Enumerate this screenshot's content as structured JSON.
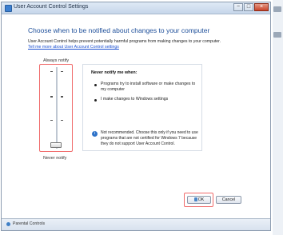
{
  "window": {
    "title": "User Account Control Settings",
    "minimize_glyph": "−",
    "maximize_glyph": "□",
    "close_glyph": "×"
  },
  "main": {
    "heading": "Choose when to be notified about changes to your computer",
    "intro": "User Account Control helps prevent potentially harmful programs from making changes to your computer.",
    "intro_link": "Tell me more about User Account Control settings"
  },
  "slider": {
    "top_label": "Always notify",
    "bottom_label": "Never notify",
    "level": 0,
    "levels": 4
  },
  "description": {
    "title": "Never notify me when:",
    "bullets": [
      "Programs try to install software or make changes to my computer",
      "I make changes to Windows settings"
    ],
    "warning": "Not recommended. Choose this only if you need to use programs that are not certified for Windows 7 because they do not support User Account Control.",
    "info_glyph": "i"
  },
  "buttons": {
    "ok": "OK",
    "cancel": "Cancel"
  },
  "status": {
    "text": "Parental Controls"
  },
  "colors": {
    "heading": "#1e4f9a",
    "highlight": "#f06b6b",
    "link": "#1a4fd0"
  }
}
